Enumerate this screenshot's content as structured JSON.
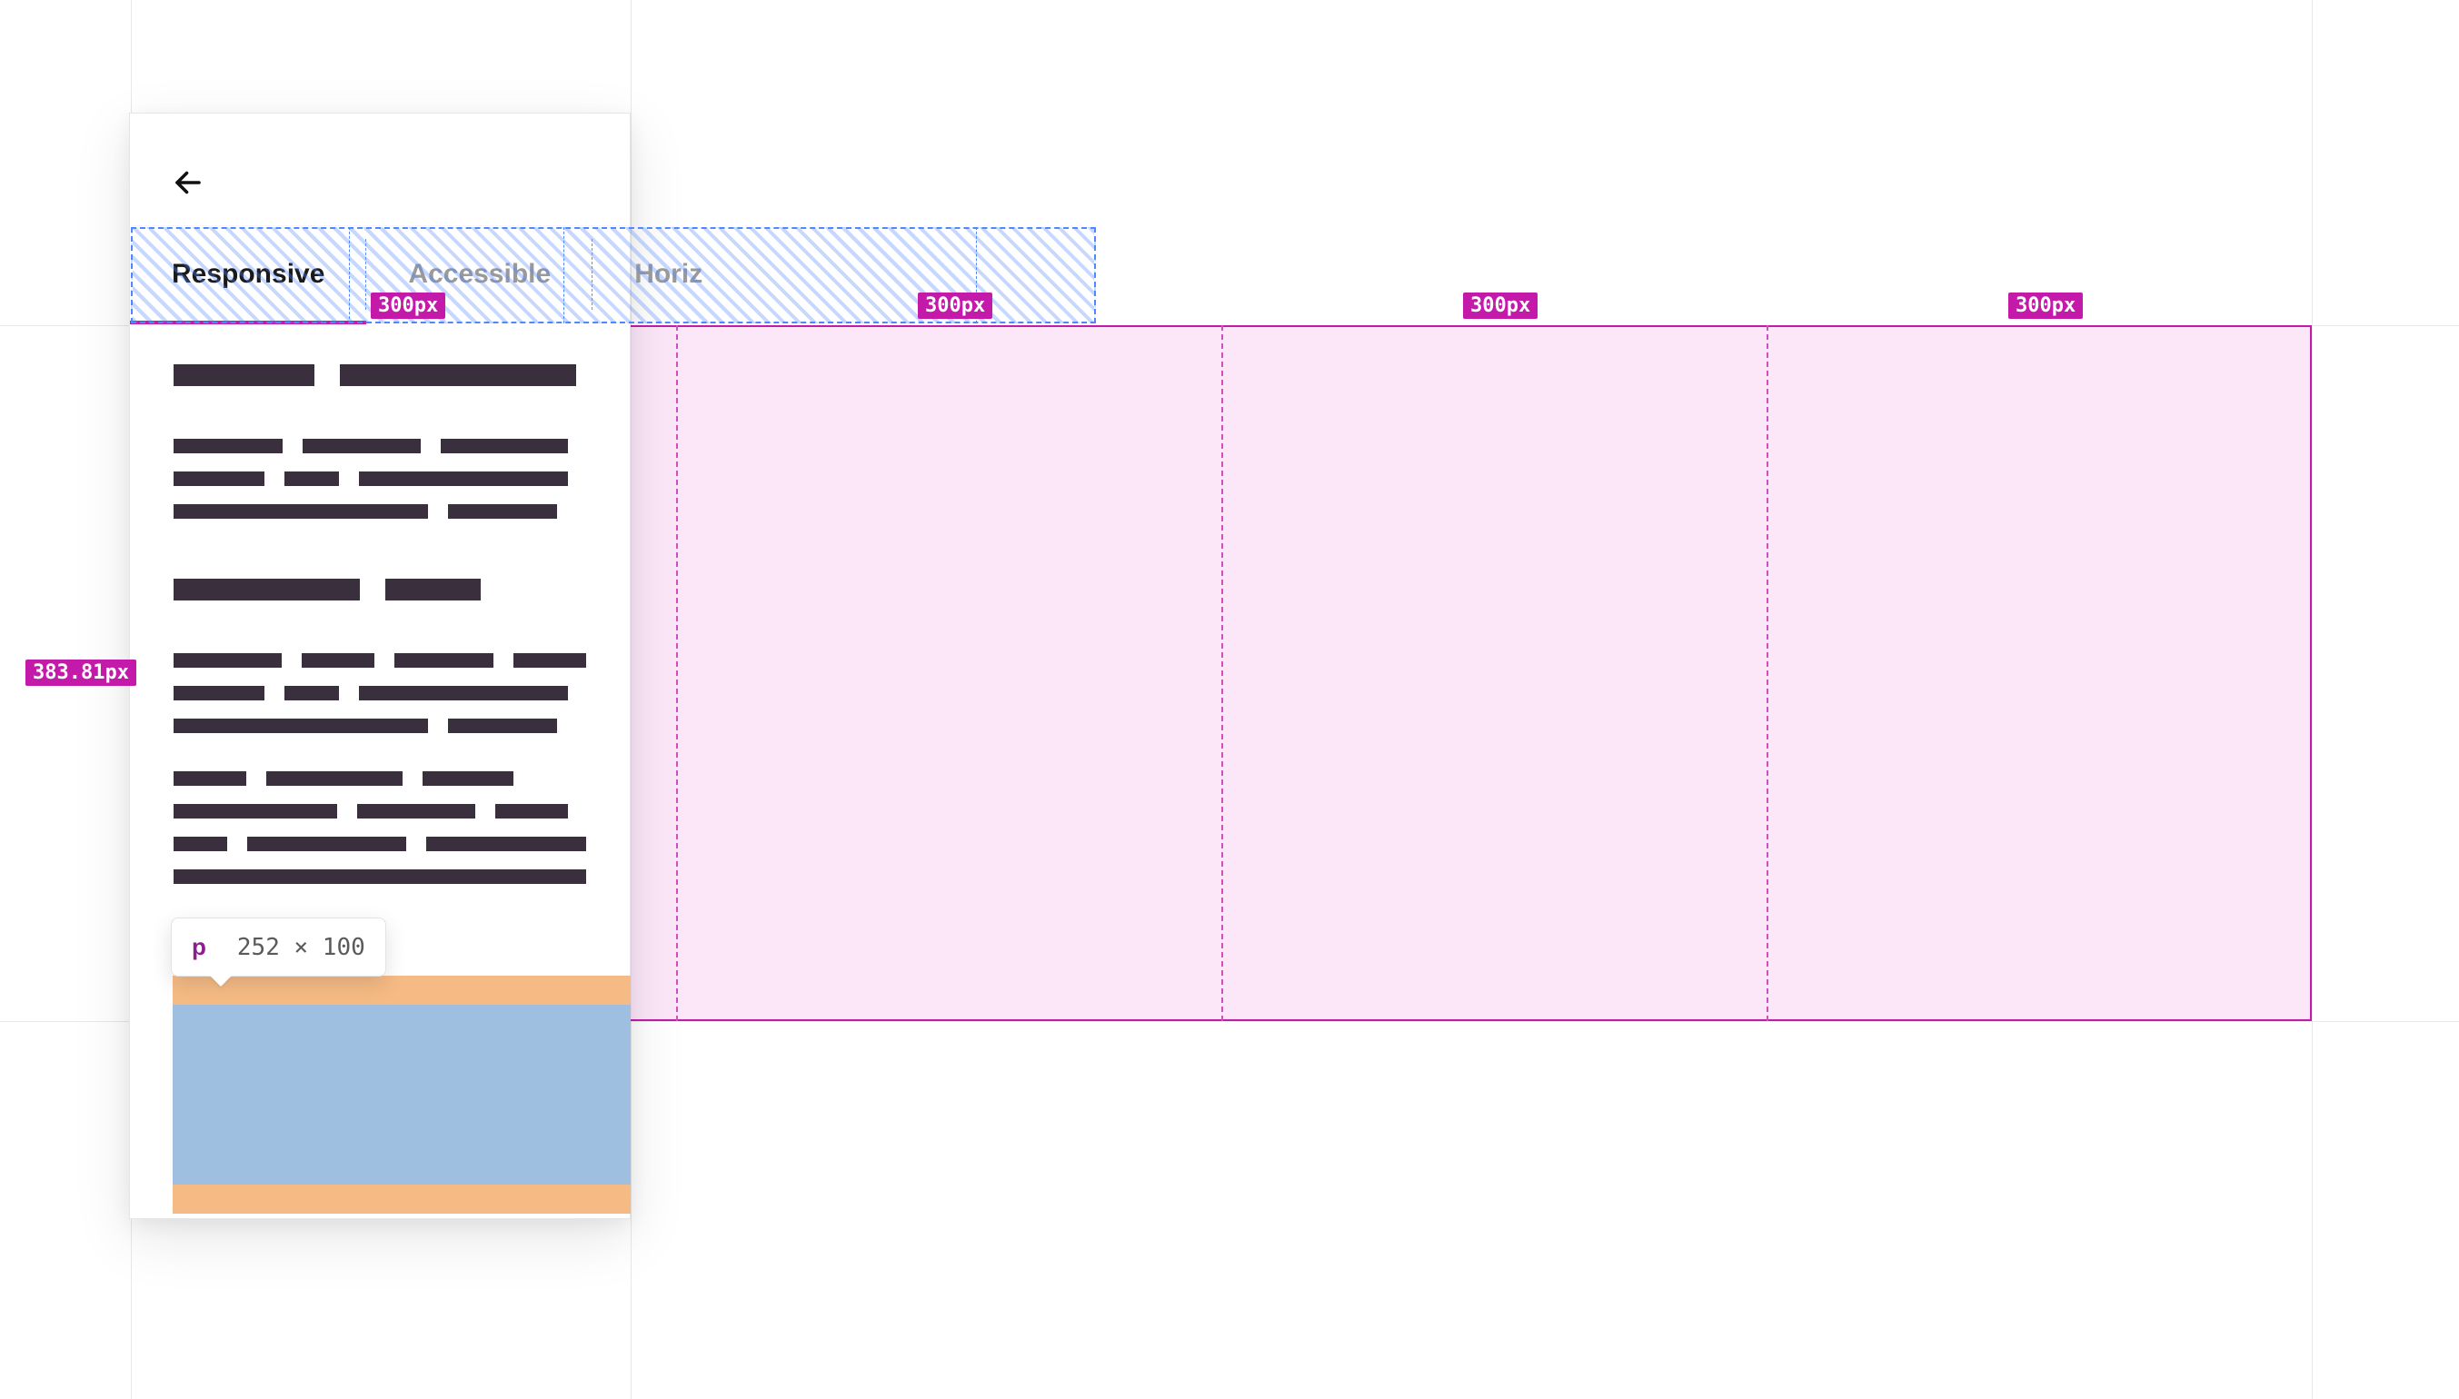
{
  "tabs": {
    "items": [
      {
        "label": "Responsive",
        "active": true
      },
      {
        "label": "Accessible",
        "active": false
      },
      {
        "label": "Horizontal",
        "active": false
      }
    ],
    "visible_third_label": "Horiz"
  },
  "grid_overlay": {
    "column_labels": [
      "300px",
      "300px",
      "300px",
      "300px"
    ],
    "height_label": "383.81px"
  },
  "inspect_tooltip": {
    "tag": "p",
    "dimensions": "252 × 100"
  }
}
